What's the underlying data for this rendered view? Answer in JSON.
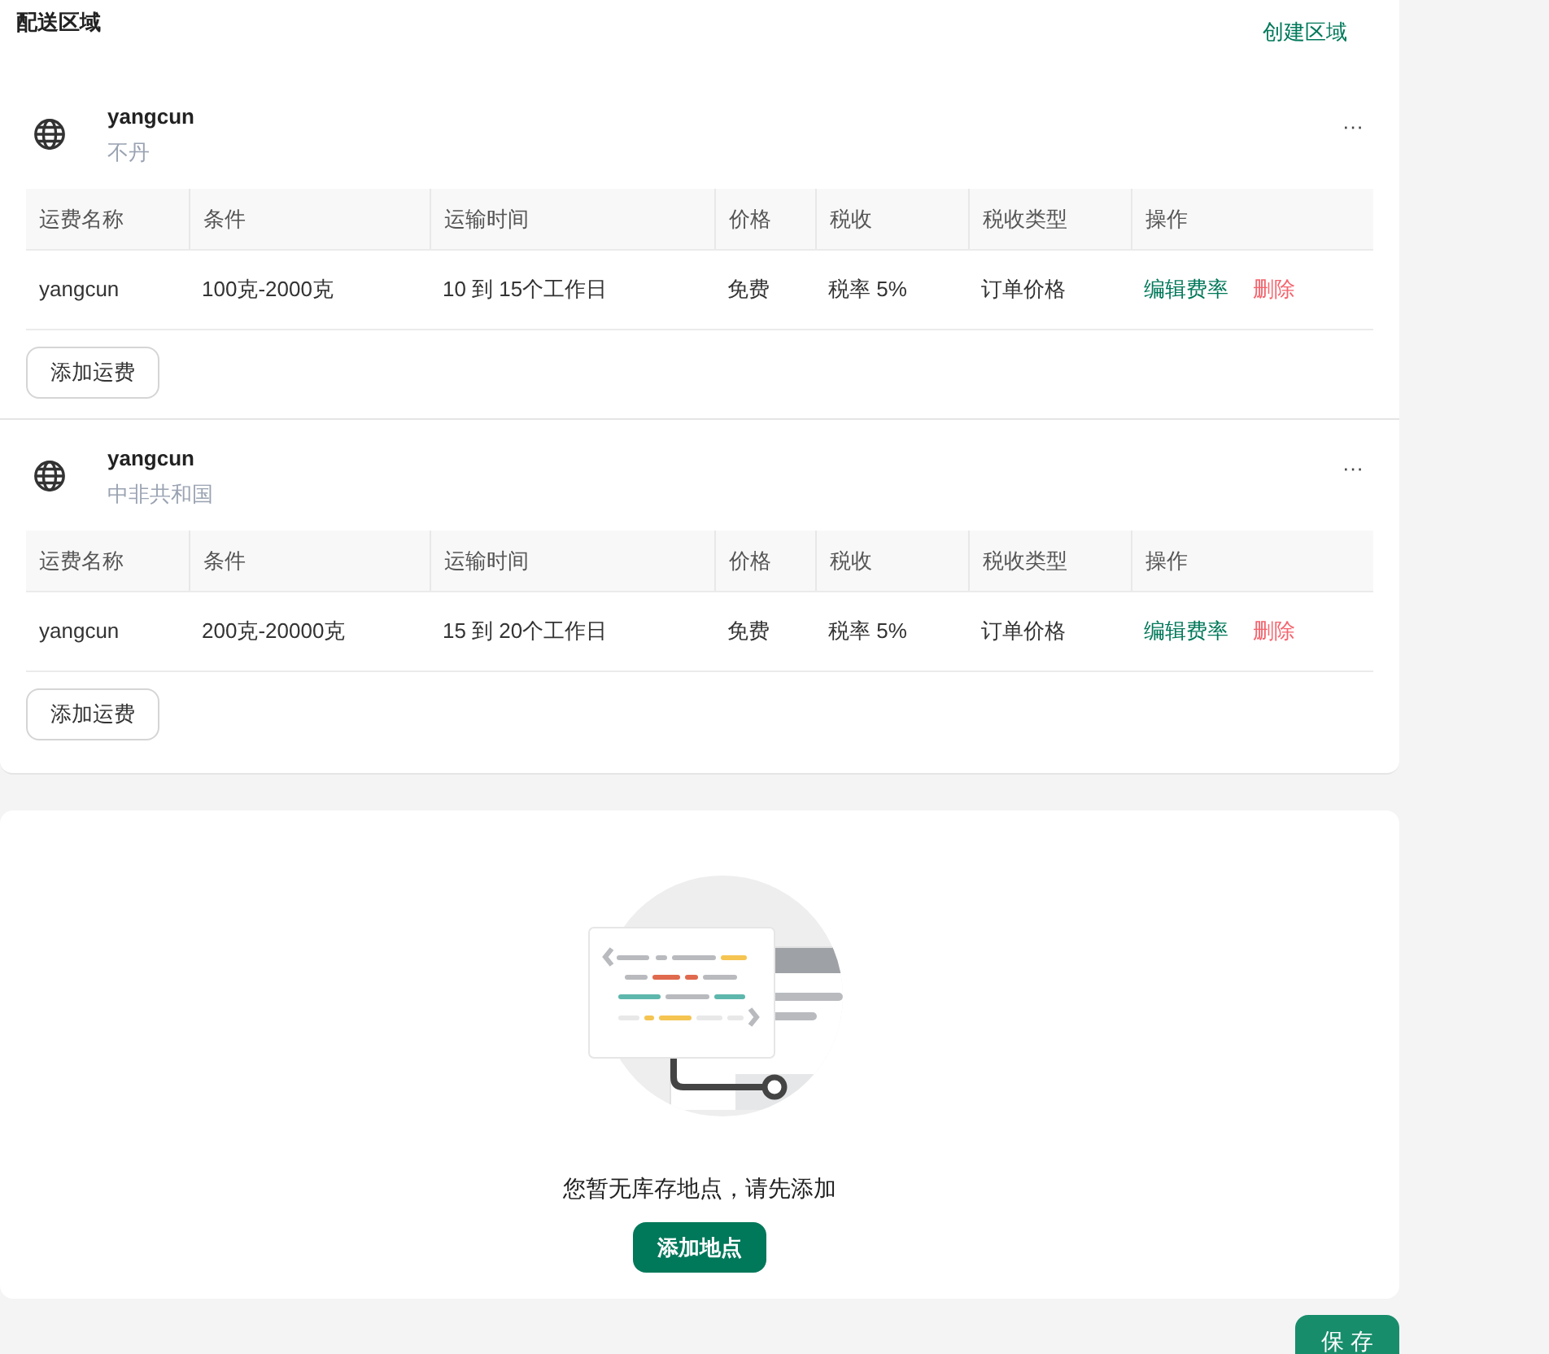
{
  "header": {
    "title": "配送区域",
    "create_link": "创建区域"
  },
  "zones": [
    {
      "name": "yangcun",
      "country": "不丹",
      "more": "···",
      "columns": [
        "运费名称",
        "条件",
        "运输时间",
        "价格",
        "税收",
        "税收类型",
        "操作"
      ],
      "rows": [
        {
          "cells": [
            "yangcun",
            "100克-2000克",
            "10 到 15个工作日",
            "免费",
            "税率 5%",
            "订单价格"
          ],
          "edit": "编辑费率",
          "delete": "删除"
        }
      ],
      "add_button": "添加运费"
    },
    {
      "name": "yangcun",
      "country": "中非共和国",
      "more": "···",
      "columns": [
        "运费名称",
        "条件",
        "运输时间",
        "价格",
        "税收",
        "税收类型",
        "操作"
      ],
      "rows": [
        {
          "cells": [
            "yangcun",
            "200克-20000克",
            "15 到 20个工作日",
            "免费",
            "税率 5%",
            "订单价格"
          ],
          "edit": "编辑费率",
          "delete": "删除"
        }
      ],
      "add_button": "添加运费"
    }
  ],
  "empty_state": {
    "message": "您暂无库存地点，请先添加",
    "button": "添加地点"
  },
  "save_button": "保存"
}
